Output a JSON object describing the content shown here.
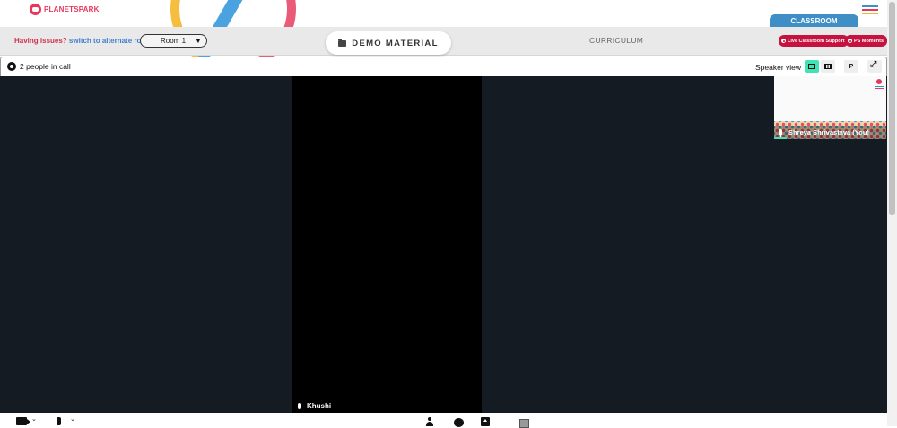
{
  "brand": {
    "logo_text": "PLANETSPARK"
  },
  "header": {
    "classroom_tab": "CLASSROOM",
    "menu_colors": [
      "#3f8fc6",
      "#e8375a",
      "#f6b82b",
      "#3fbf8f"
    ]
  },
  "menubar": {
    "issues_question": "Having issues?",
    "issues_link": "switch to alternate room",
    "room_select": {
      "selected": "Room 1"
    },
    "demo_material": "DEMO MATERIAL",
    "curriculum": "CURRICULUM",
    "live_support": "Live Classroom Support",
    "ps_moments": "PS Moments"
  },
  "call": {
    "people_count": "2 people in call",
    "view_label": "Speaker view",
    "p_button": "P"
  },
  "participants": {
    "main": {
      "name": "Khushi"
    },
    "self": {
      "name": "Shreya Shrivastava (You)"
    }
  },
  "colors": {
    "accent": "#3fe3b6",
    "brand_red": "#c5123f",
    "classroom_blue": "#3f8fc6",
    "stage_bg": "#141b22"
  }
}
